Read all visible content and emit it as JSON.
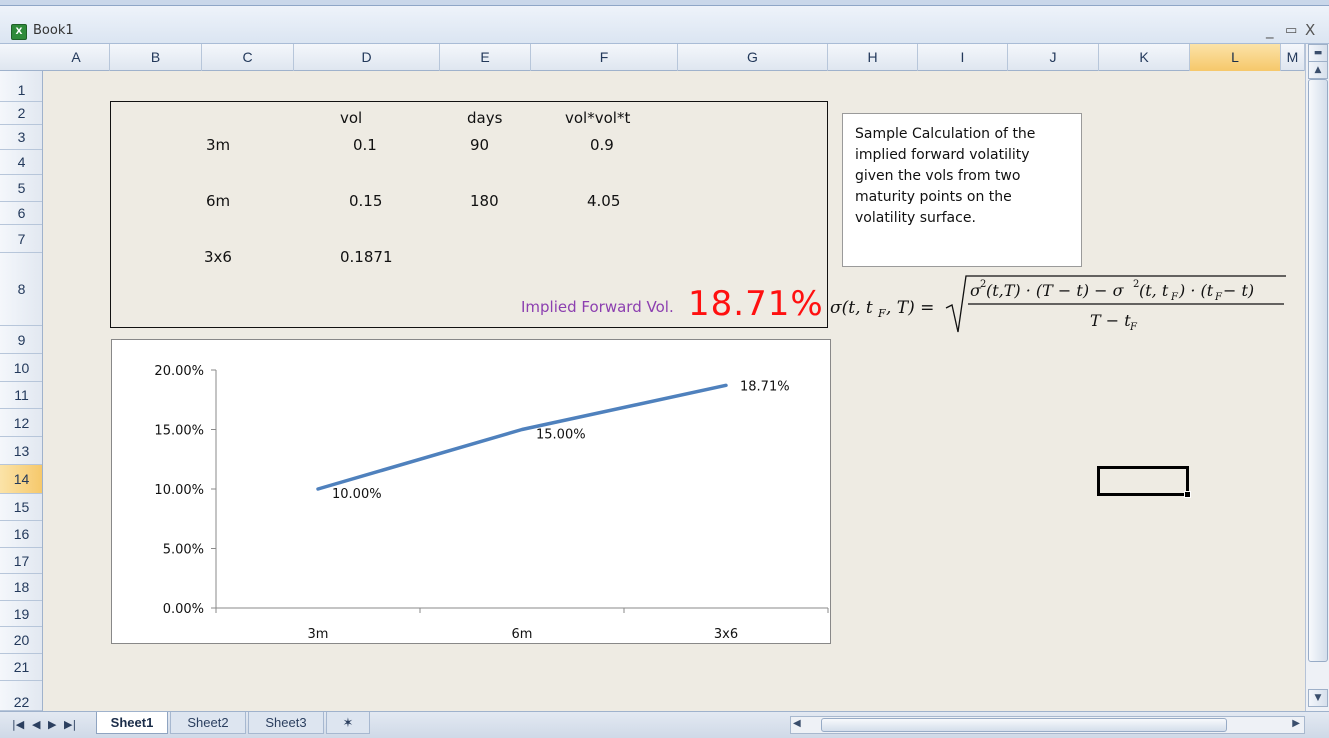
{
  "window": {
    "title": "Book1",
    "app_icon": "excel-icon",
    "minimize": "_",
    "restore": "▭",
    "close": "X"
  },
  "columns": [
    "A",
    "B",
    "C",
    "D",
    "E",
    "F",
    "G",
    "H",
    "I",
    "J",
    "K",
    "L",
    "M"
  ],
  "selected_column": "L",
  "rows": [
    "1",
    "2",
    "3",
    "4",
    "5",
    "6",
    "7",
    "8",
    "9",
    "10",
    "11",
    "12",
    "13",
    "14",
    "15",
    "16",
    "17",
    "18",
    "19",
    "20",
    "21",
    "22"
  ],
  "selected_row": "14",
  "table": {
    "headers": {
      "vol": "vol",
      "days": "days",
      "varcalc": "vol*vol*t"
    },
    "row_3m": {
      "label": "3m",
      "vol": "0.1",
      "days": "90",
      "varcalc": "0.9"
    },
    "row_6m": {
      "label": "6m",
      "vol": "0.15",
      "days": "180",
      "varcalc": "4.05"
    },
    "row_3x6": {
      "label": "3x6",
      "vol": "0.1871"
    }
  },
  "implied": {
    "label": "Implied Forward Vol.",
    "value": "18.71%"
  },
  "note": "Sample Calculation of the implied forward volatility given the vols from two maturity points on the volatility surface.",
  "chart_data": {
    "type": "line",
    "categories": [
      "3m",
      "6m",
      "3x6"
    ],
    "values": [
      0.1,
      0.15,
      0.1871
    ],
    "data_labels": [
      "10.00%",
      "15.00%",
      "18.71%"
    ],
    "y_ticks": [
      "0.00%",
      "5.00%",
      "10.00%",
      "15.00%",
      "20.00%"
    ],
    "ylim": [
      0,
      0.2
    ],
    "title": "",
    "xlabel": "",
    "ylabel": "",
    "line_color": "#4f81bd",
    "legend": "none",
    "grid": false
  },
  "sheet_tabs": [
    "Sheet1",
    "Sheet2",
    "Sheet3"
  ],
  "active_sheet": "Sheet1",
  "colors": {
    "big_value": "#ff1010",
    "implied_label": "#8c3fb0",
    "sheet_bg": "#eeebe3",
    "header_selected": "#f6c86a"
  }
}
